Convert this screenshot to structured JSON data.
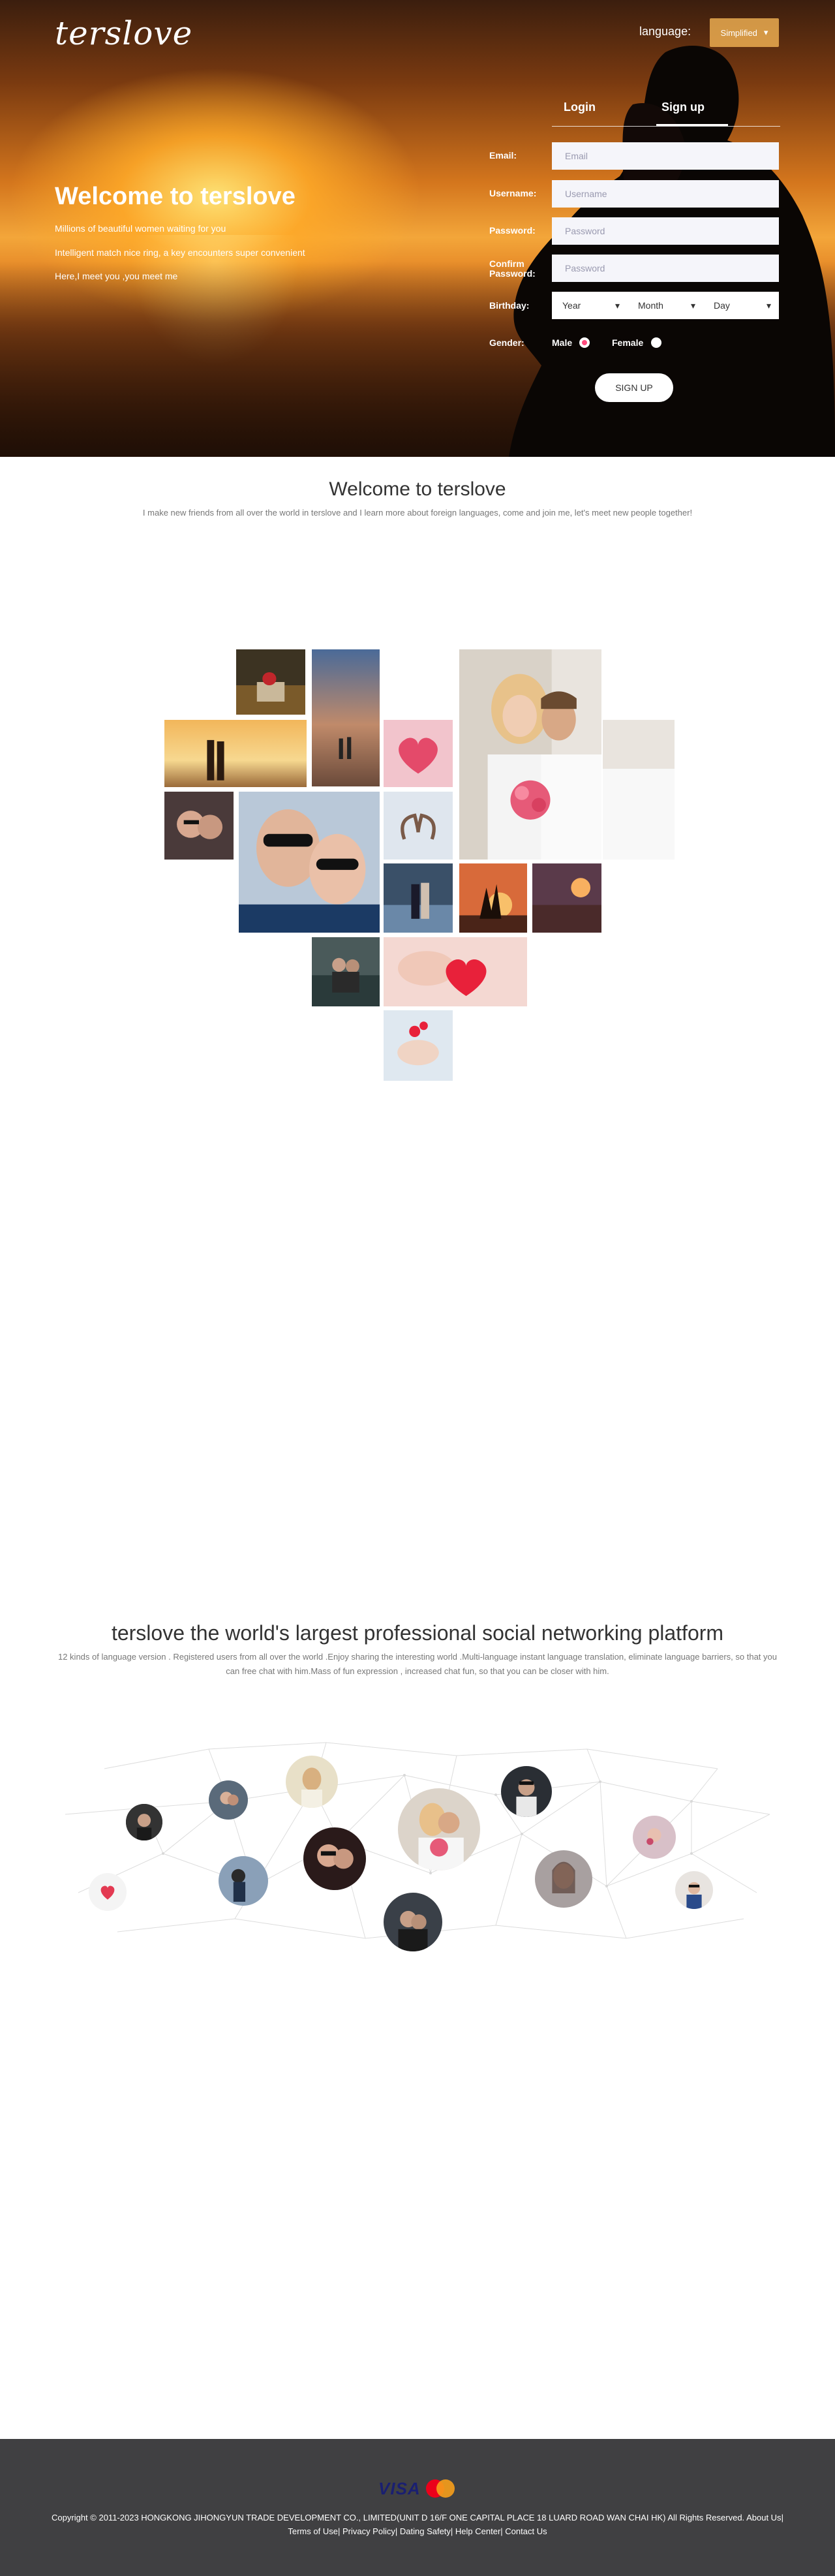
{
  "header": {
    "logo": "terslove",
    "language_label": "language:",
    "language_value": "Simplified"
  },
  "hero": {
    "title": "Welcome to terslove",
    "lines": [
      "Millions of beautiful women waiting for you",
      "Intelligent match nice ring, a key encounters super convenient",
      "Here,I meet you ,you meet me"
    ]
  },
  "form": {
    "tabs": {
      "login": "Login",
      "signup": "Sign up"
    },
    "active_tab": "signup",
    "email_label": "Email:",
    "email_placeholder": "Email",
    "username_label": "Username:",
    "username_placeholder": "Username",
    "password_label": "Password:",
    "password_placeholder": "Password",
    "confirm_label": "Confirm Password:",
    "confirm_placeholder": "Password",
    "birthday_label": "Birthday:",
    "year": "Year",
    "month": "Month",
    "day": "Day",
    "gender_label": "Gender:",
    "male": "Male",
    "female": "Female",
    "selected_gender": "Male",
    "submit": "SIGN UP"
  },
  "section_welcome": {
    "title": "Welcome to terslove",
    "subtitle": "I make new friends from all over the world in terslove and I learn more about foreign languages, come and join me, let's meet new people together!"
  },
  "section_platform": {
    "title": "terslove the world's largest professional social networking platform",
    "subtitle": "12 kinds of language version . Registered users from all over the world .Enjoy sharing the interesting world .Multi-language instant language translation, eliminate language barriers, so that you can free chat with him.Mass of fun expression , increased chat fun, so that you can be closer with him."
  },
  "footer": {
    "visa": "VISA",
    "copyright": "Copyright © 2011-2023 HONGKONG JIHONGYUN TRADE DEVELOPMENT CO., LIMITED(UNIT D 16/F ONE CAPITAL PLACE 18 LUARD ROAD WAN CHAI HK) All Rights Reserved.",
    "links": [
      "About Us",
      "Terms of Use",
      "Privacy Policy",
      "Dating Safety",
      "Help Center",
      "Contact Us"
    ]
  },
  "colors": {
    "accent": "#ff4b7d",
    "footer_bg": "#404042"
  }
}
